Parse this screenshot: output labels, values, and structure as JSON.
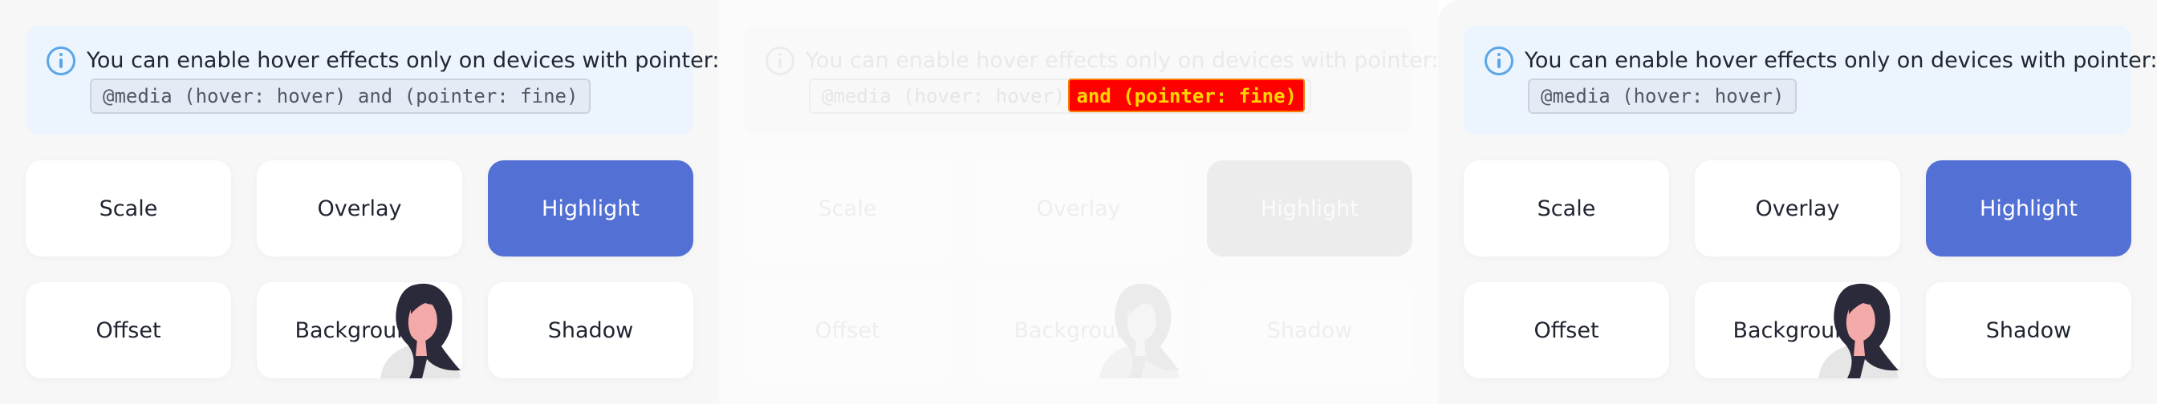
{
  "panels": [
    {
      "notice_text": "You can enable hover effects only on devices with pointer:",
      "code": "@media (hover: hover) and (pointer: fine)",
      "buttons": [
        "Scale",
        "Overlay",
        "Highlight",
        "Offset",
        "Background",
        "Shadow"
      ]
    },
    {
      "notice_text": "You can enable hover effects only on devices with pointer:",
      "code": "@media (hover: hover)",
      "code_highlight": "and (pointer: fine)",
      "buttons": [
        "Scale",
        "Overlay",
        "Highlight",
        "Offset",
        "Background",
        "Shadow"
      ]
    },
    {
      "notice_text": "You can enable hover effects only on devices with pointer:",
      "code": "@media (hover: hover)",
      "buttons": [
        "Scale",
        "Overlay",
        "Highlight",
        "Offset",
        "Background",
        "Shadow"
      ]
    }
  ],
  "colors": {
    "accent": "#5370d4",
    "info": "#5aa6e8",
    "notice_bg": "#ecf4fd",
    "code_highlight_bg": "#ff0000",
    "code_highlight_text": "#ffd500"
  },
  "icons": {
    "info": "info-circle-icon",
    "avatar": "woman-avatar-illustration"
  }
}
